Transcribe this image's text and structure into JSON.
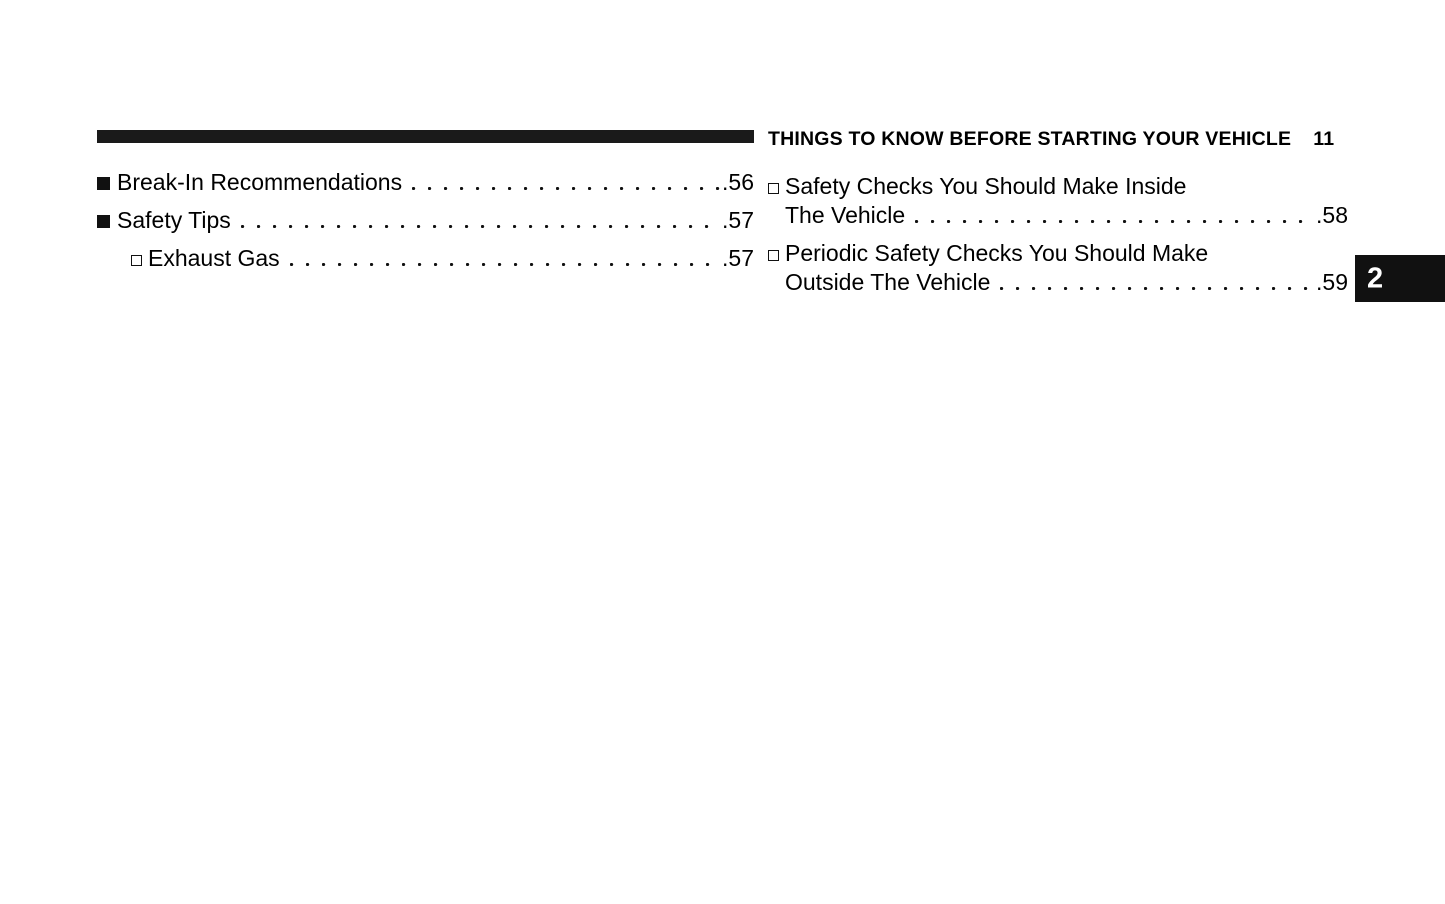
{
  "document": {
    "type": "owner-manual-table-of-contents",
    "page_background": "#ffffff",
    "ink_color": "#111111"
  },
  "left_column": {
    "rule_bar": true,
    "entries": [
      {
        "bullet": "filled-square",
        "level": 1,
        "lines": [
          "Break-In Recommendations"
        ],
        "page": "56"
      },
      {
        "bullet": "filled-square",
        "level": 1,
        "lines": [
          "Safety Tips"
        ],
        "page": "57"
      },
      {
        "bullet": "hollow-square",
        "level": 2,
        "lines": [
          "Exhaust Gas"
        ],
        "page": "57"
      }
    ]
  },
  "right_column": {
    "header": {
      "title": "THINGS TO KNOW BEFORE STARTING YOUR VEHICLE",
      "page": "11"
    },
    "entries": [
      {
        "bullet": "hollow-square",
        "level": 2,
        "lines": [
          "Safety Checks You Should Make Inside",
          "The Vehicle"
        ],
        "page": "58"
      },
      {
        "bullet": "hollow-square",
        "level": 2,
        "lines": [
          "Periodic Safety Checks You Should Make",
          "Outside The Vehicle"
        ],
        "page": "59"
      }
    ]
  },
  "chapter_tab": {
    "number": "2",
    "background": "#111111",
    "text_color": "#ffffff"
  }
}
